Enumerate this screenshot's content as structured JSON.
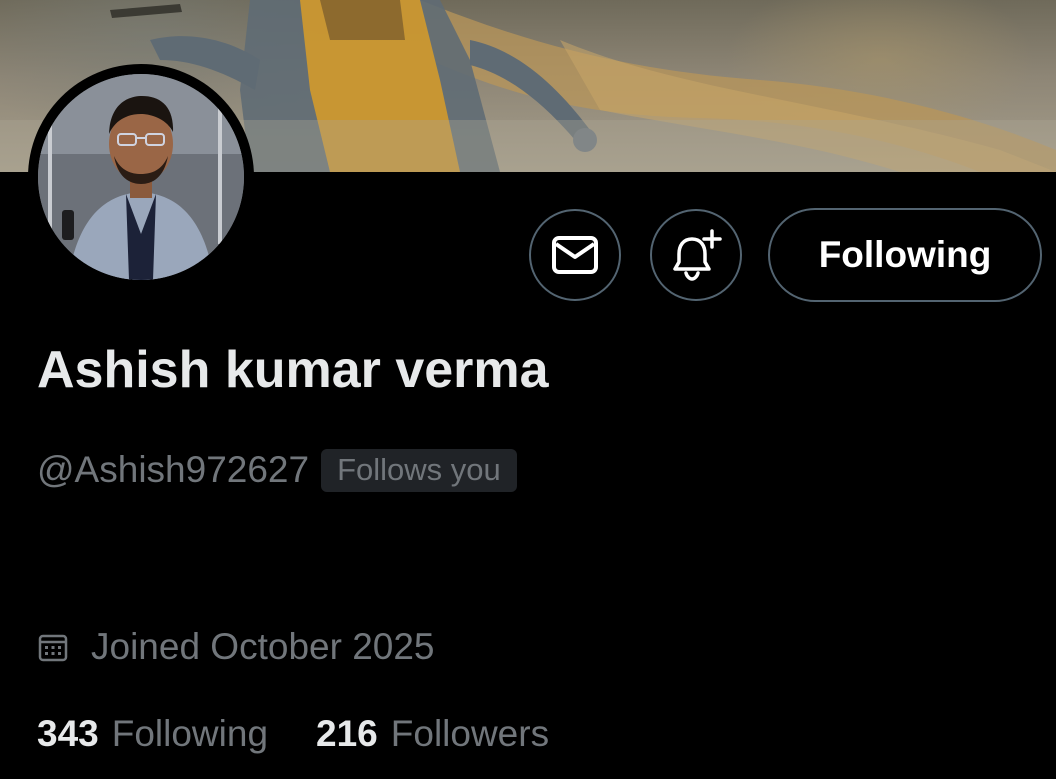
{
  "profile": {
    "display_name": "Ashish kumar verma",
    "handle": "@Ashish972627",
    "follows_you_badge": "Follows you",
    "joined": "Joined October 2025"
  },
  "actions": {
    "message_icon": "envelope-icon",
    "notify_icon": "bell-plus-icon",
    "follow_label": "Following"
  },
  "stats": {
    "following_count": "343",
    "following_label": "Following",
    "followers_count": "216",
    "followers_label": "Followers"
  },
  "icons": {
    "calendar": "calendar-icon"
  },
  "colors": {
    "background": "#000000",
    "primary_text": "#e7e9ea",
    "secondary_text": "#71767b",
    "border": "#536471",
    "badge_background": "#202327"
  }
}
